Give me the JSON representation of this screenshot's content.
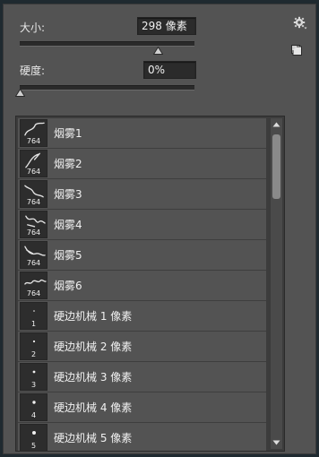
{
  "size": {
    "label": "大小:",
    "value": "298 像素",
    "level": 0.79
  },
  "hardness": {
    "label": "硬度:",
    "value": "0%",
    "level": 0.0
  },
  "icons": {
    "gear": "gear-icon",
    "new_preset": "new-preset-icon"
  },
  "presets": [
    {
      "name": "烟雾1",
      "size": "764",
      "kind": "smoke"
    },
    {
      "name": "烟雾2",
      "size": "764",
      "kind": "smoke"
    },
    {
      "name": "烟雾3",
      "size": "764",
      "kind": "smoke"
    },
    {
      "name": "烟雾4",
      "size": "764",
      "kind": "smoke"
    },
    {
      "name": "烟雾5",
      "size": "764",
      "kind": "smoke"
    },
    {
      "name": "烟雾6",
      "size": "764",
      "kind": "smoke"
    },
    {
      "name": "硬边机械 1 像素",
      "size": "1",
      "kind": "dot"
    },
    {
      "name": "硬边机械 2 像素",
      "size": "2",
      "kind": "dot"
    },
    {
      "name": "硬边机械 3 像素",
      "size": "3",
      "kind": "dot"
    },
    {
      "name": "硬边机械 4 像素",
      "size": "4",
      "kind": "dot"
    },
    {
      "name": "硬边机械 5 像素",
      "size": "5",
      "kind": "dot"
    }
  ]
}
